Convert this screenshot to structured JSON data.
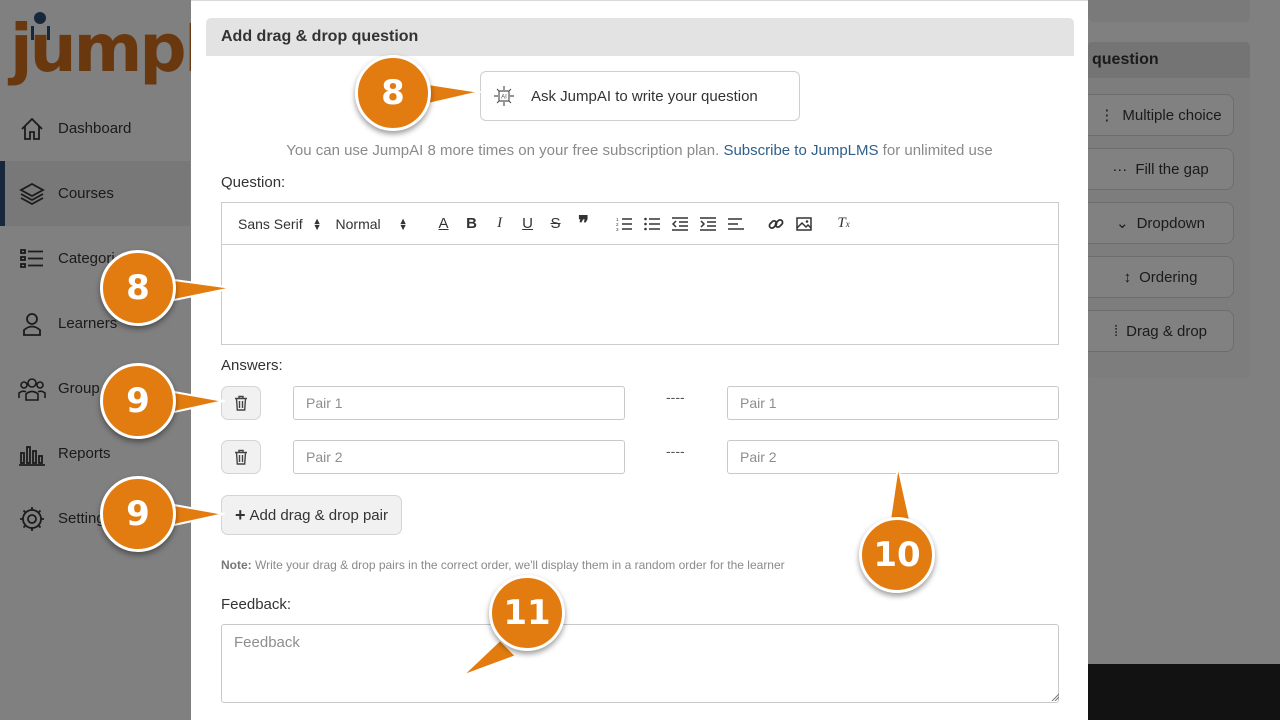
{
  "app": {
    "logo_text": "jumpIn",
    "nav": [
      {
        "label": "Dashboard",
        "icon": "home-icon"
      },
      {
        "label": "Courses",
        "icon": "stack-icon"
      },
      {
        "label": "Categori",
        "icon": "list-icon"
      },
      {
        "label": "Learners",
        "icon": "person-icon"
      },
      {
        "label": "Group",
        "icon": "users-icon"
      },
      {
        "label": "Reports",
        "icon": "bar-chart-icon"
      },
      {
        "label": "Setting",
        "icon": "gear-icon"
      }
    ],
    "right_panel": {
      "title": "question",
      "types": [
        {
          "label": "Multiple choice",
          "icon": "list-bullet-icon",
          "glyph": "⋮"
        },
        {
          "label": "Fill the gap",
          "icon": "dots-icon",
          "glyph": "···"
        },
        {
          "label": "Dropdown",
          "icon": "chevron-down-icon",
          "glyph": "⌄"
        },
        {
          "label": "Ordering",
          "icon": "updown-arrow-icon",
          "glyph": "↕"
        },
        {
          "label": "Drag & drop",
          "icon": "grip-icon",
          "glyph": "⁞"
        }
      ]
    }
  },
  "modal": {
    "title": "Add drag & drop question",
    "ai_button": "Ask JumpAI to write your question",
    "ai_note_pre": "You can use JumpAI 8 more times on your free subscription plan. ",
    "ai_note_link": "Subscribe to JumpLMS",
    "ai_note_post": " for unlimited use",
    "question_label": "Question:",
    "toolbar": {
      "font": "Sans Serif",
      "size": "Normal"
    },
    "answers_label": "Answers:",
    "pairs": [
      {
        "left_placeholder": "Pair 1",
        "right_placeholder": "Pair 1"
      },
      {
        "left_placeholder": "Pair 2",
        "right_placeholder": "Pair 2"
      }
    ],
    "separator": "----",
    "add_pair_button": "Add drag & drop pair",
    "note_bold": "Note:",
    "note_text": " Write your drag & drop pairs in the correct order, we'll display them in a random order for the learner",
    "feedback_label": "Feedback:",
    "feedback_placeholder": "Feedback"
  },
  "callouts": [
    "8",
    "8",
    "9",
    "9",
    "10",
    "11"
  ],
  "colors": {
    "callout": "#e37c10",
    "link": "#2d5f8a",
    "brand_blue": "#2d4d72",
    "brand_orange": "#c86a1e"
  }
}
